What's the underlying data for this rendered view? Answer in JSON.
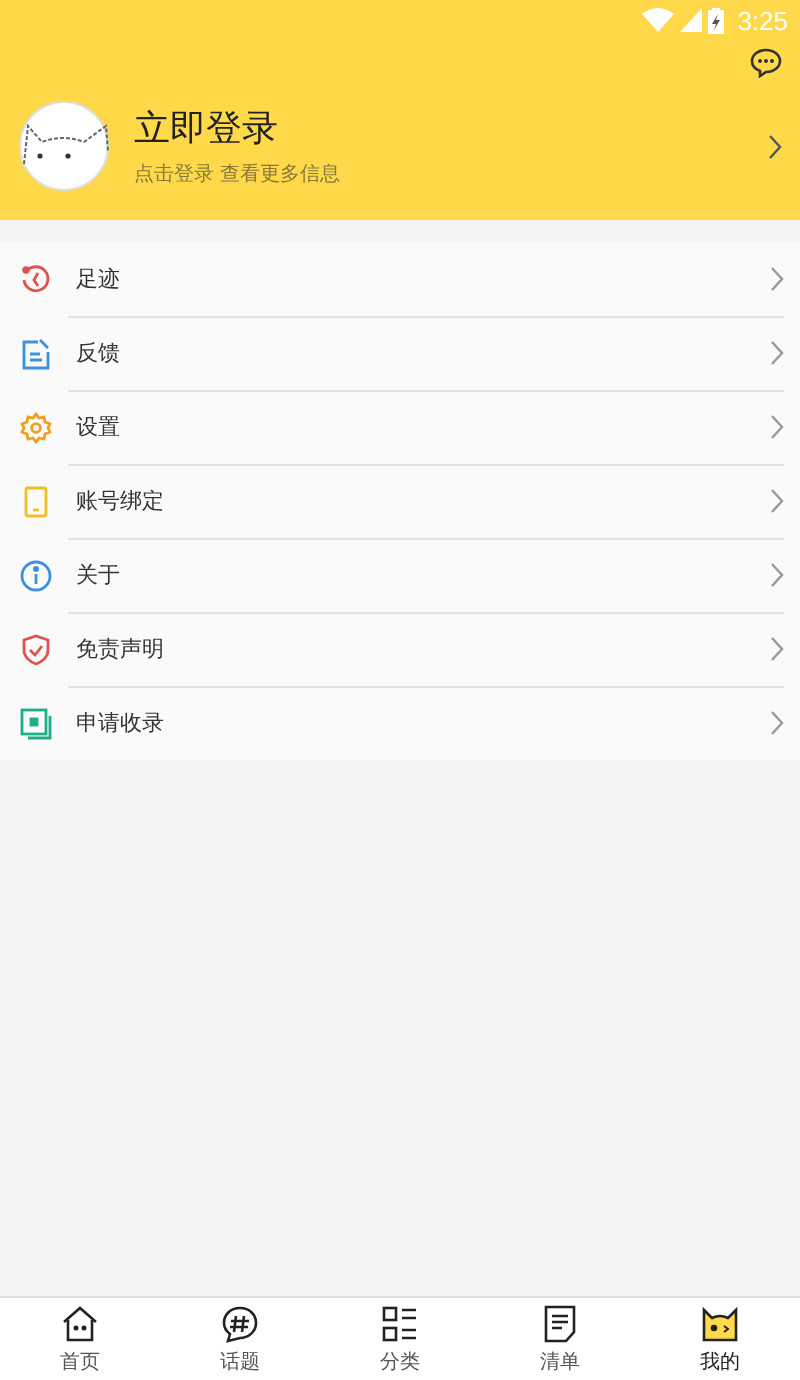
{
  "status_bar": {
    "time": "3:25"
  },
  "profile": {
    "title": "立即登录",
    "subtitle": "点击登录 查看更多信息"
  },
  "menu": [
    {
      "kind": "history",
      "label": "足迹",
      "color": "#e0534d"
    },
    {
      "kind": "feedback",
      "label": "反馈",
      "color": "#3d8fe0"
    },
    {
      "kind": "settings",
      "label": "设置",
      "color": "#f0a020"
    },
    {
      "kind": "account",
      "label": "账号绑定",
      "color": "#f0c020"
    },
    {
      "kind": "about",
      "label": "关于",
      "color": "#3d8fe0"
    },
    {
      "kind": "shield",
      "label": "免责声明",
      "color": "#e0534d"
    },
    {
      "kind": "apply",
      "label": "申请收录",
      "color": "#1fae8a"
    }
  ],
  "tabs": [
    {
      "kind": "home",
      "label": "首页",
      "selected": false
    },
    {
      "kind": "topic",
      "label": "话题",
      "selected": false
    },
    {
      "kind": "category",
      "label": "分类",
      "selected": false
    },
    {
      "kind": "list",
      "label": "清单",
      "selected": false
    },
    {
      "kind": "mine",
      "label": "我的",
      "selected": true
    }
  ]
}
